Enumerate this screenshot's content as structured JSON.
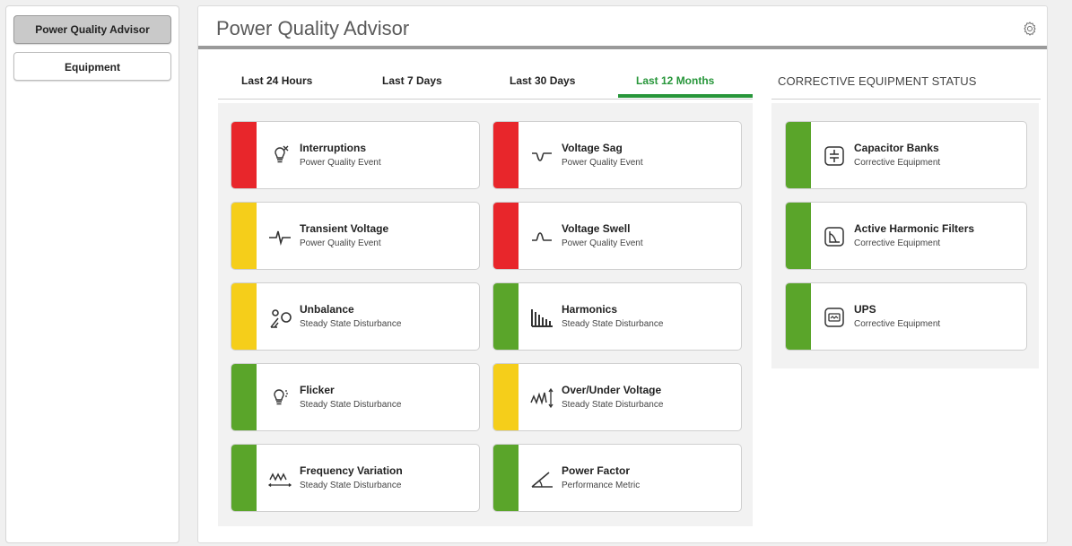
{
  "sidebar": {
    "items": [
      {
        "label": "Power Quality Advisor"
      },
      {
        "label": "Equipment"
      }
    ]
  },
  "header": {
    "title": "Power Quality Advisor",
    "settings_icon": "gear-icon"
  },
  "tabs": [
    {
      "label": "Last 24 Hours"
    },
    {
      "label": "Last 7 Days"
    },
    {
      "label": "Last 30 Days"
    },
    {
      "label": "Last 12 Months",
      "active": true
    }
  ],
  "colors": {
    "red": "#e8262b",
    "yellow": "#f5ce1a",
    "green": "#5aa52a",
    "accent": "#27963a"
  },
  "events": [
    {
      "name": "Interruptions",
      "category": "Power Quality Event",
      "status": "red",
      "icon": "bulb-off-icon"
    },
    {
      "name": "Voltage Sag",
      "category": "Power Quality Event",
      "status": "red",
      "icon": "voltage-sag-icon"
    },
    {
      "name": "Transient Voltage",
      "category": "Power Quality Event",
      "status": "yellow",
      "icon": "transient-icon"
    },
    {
      "name": "Voltage Swell",
      "category": "Power Quality Event",
      "status": "red",
      "icon": "voltage-swell-icon"
    },
    {
      "name": "Unbalance",
      "category": "Steady State Disturbance",
      "status": "yellow",
      "icon": "unbalance-icon"
    },
    {
      "name": "Harmonics",
      "category": "Steady State Disturbance",
      "status": "green",
      "icon": "harmonics-icon"
    },
    {
      "name": "Flicker",
      "category": "Steady State Disturbance",
      "status": "green",
      "icon": "flicker-bulb-icon"
    },
    {
      "name": "Over/Under Voltage",
      "category": "Steady State Disturbance",
      "status": "yellow",
      "icon": "over-under-voltage-icon"
    },
    {
      "name": "Frequency Variation",
      "category": "Steady State Disturbance",
      "status": "green",
      "icon": "frequency-icon"
    },
    {
      "name": "Power Factor",
      "category": "Performance Metric",
      "status": "green",
      "icon": "angle-icon"
    }
  ],
  "corrective": {
    "title": "CORRECTIVE EQUIPMENT STATUS",
    "items": [
      {
        "name": "Capacitor Banks",
        "category": "Corrective Equipment",
        "status": "green",
        "icon": "capacitor-icon"
      },
      {
        "name": "Active Harmonic Filters",
        "category": "Corrective Equipment",
        "status": "green",
        "icon": "filter-icon"
      },
      {
        "name": "UPS",
        "category": "Corrective Equipment",
        "status": "green",
        "icon": "ups-icon"
      }
    ]
  }
}
